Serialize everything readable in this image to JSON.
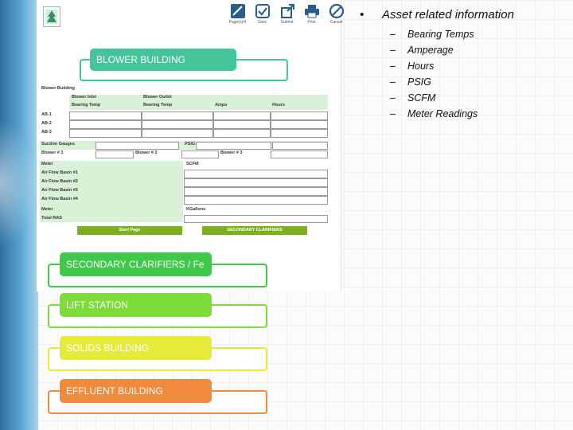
{
  "toolbar": {
    "items": [
      {
        "label": "Page(s)/4"
      },
      {
        "label": "Save"
      },
      {
        "label": "Submit"
      },
      {
        "label": "Print"
      },
      {
        "label": "Cancel"
      }
    ]
  },
  "sections": {
    "blower": "BLOWER BUILDING",
    "secondary": "SECONDARY CLARIFIERS / Fe",
    "lift": "LIFT STATION",
    "solids": "SOLIDS BUILDING",
    "effluent": "EFFLUENT BUILDING"
  },
  "form": {
    "title": "Blower Building",
    "col_inlet": "Blower Inlet",
    "col_outlet": "Blower Outlet",
    "col_bearing1": "Bearing Temp",
    "col_bearing2": "Bearing Temp",
    "col_amps": "Amps",
    "col_hours": "Hours",
    "rows": [
      "AB-1",
      "AB-2",
      "AB-3"
    ],
    "suction": "Suction Gauges",
    "psig": "PSIG",
    "blower1": "Blower # 1",
    "blower2": "Blower # 2",
    "blower3": "Blower # 3",
    "meter1": "Meter",
    "scfm": "SCFM",
    "basins": [
      "Air Flow Basin #1",
      "Air Flow Basin #2",
      "Air Flow Basin #3",
      "Air Flow Basin #4"
    ],
    "meter2": "Meter",
    "kgallons": "KGallons",
    "total_ras": "Total RAS",
    "start_btn": "Start Page",
    "next_btn": "SECONDARY CLARIFIERS"
  },
  "bullets": {
    "dot": "•",
    "title": "Asset related information",
    "dash": "–",
    "items": [
      "Bearing Temps",
      "Amperage",
      "Hours",
      "PSIG",
      "SCFM",
      "Meter Readings"
    ]
  },
  "colors": {
    "blower": "#45c39a",
    "secondary": "#3fc94a",
    "lift": "#7ddc3a",
    "solids": "#e6ea3a",
    "effluent": "#f08a3c",
    "form_green": "#d9f2d7",
    "button_green": "#7cb01c"
  }
}
